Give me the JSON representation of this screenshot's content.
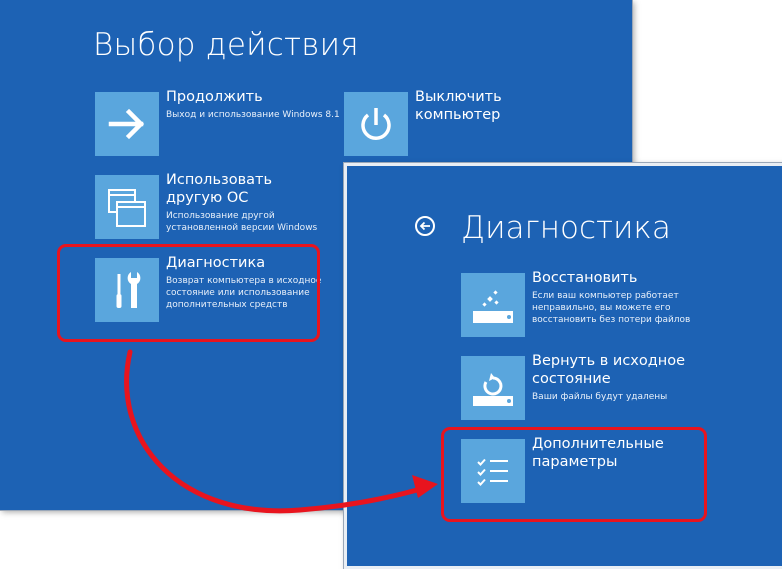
{
  "screen1": {
    "title": "Выбор действия",
    "tiles": [
      {
        "label": "Продолжить",
        "desc": "Выход и использование Windows 8.1",
        "icon": "arrow-right-icon"
      },
      {
        "label": "Выключить\nкомпьютер",
        "desc": "",
        "icon": "power-icon"
      },
      {
        "label": "Использовать\nдругую ОС",
        "desc": "Использование другой\nустановленной версии Windows",
        "icon": "windows-stack-icon"
      },
      {
        "label": "Диагностика",
        "desc": "Возврат компьютера в исходное\nсостояние или использование\nдополнительных средств",
        "icon": "tools-icon"
      }
    ]
  },
  "screen2": {
    "title": "Диагностика",
    "tiles": [
      {
        "label": "Восстановить",
        "desc": "Если ваш компьютер работает\nнеправильно, вы можете его\nвосстановить без потери файлов",
        "icon": "refresh-sparkle-icon"
      },
      {
        "label": "Вернуть в исходное\nсостояние",
        "desc": "Ваши файлы будут удалены",
        "icon": "reset-icon"
      },
      {
        "label": "Дополнительные\nпараметры",
        "desc": "",
        "icon": "checklist-icon"
      }
    ]
  },
  "colors": {
    "background": "#1d62b4",
    "tile": "#5aa6dd",
    "highlight": "#e8141e"
  }
}
